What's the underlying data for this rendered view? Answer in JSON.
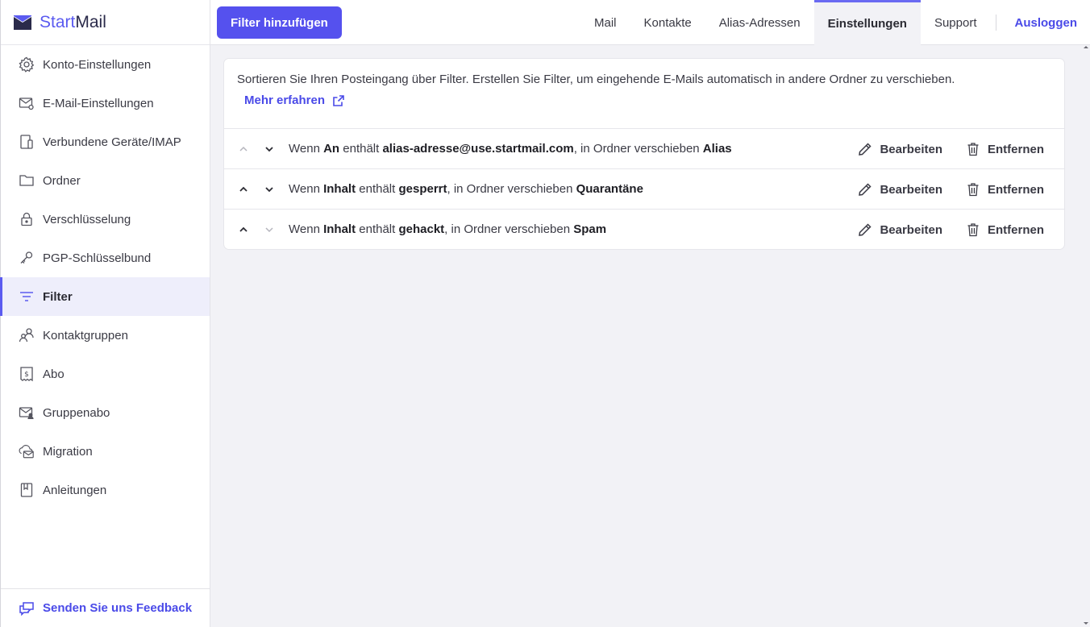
{
  "logo": {
    "part1": "Start",
    "part2": "Mail"
  },
  "sidebar": {
    "items": [
      {
        "label": "Konto-Einstellungen",
        "icon": "gear-icon"
      },
      {
        "label": "E-Mail-Einstellungen",
        "icon": "mail-settings-icon"
      },
      {
        "label": "Verbundene Geräte/IMAP",
        "icon": "devices-icon"
      },
      {
        "label": "Ordner",
        "icon": "folder-icon"
      },
      {
        "label": "Verschlüsselung",
        "icon": "lock-icon"
      },
      {
        "label": "PGP-Schlüsselbund",
        "icon": "key-icon"
      },
      {
        "label": "Filter",
        "icon": "filter-icon",
        "active": true
      },
      {
        "label": "Kontaktgruppen",
        "icon": "contact-group-icon"
      },
      {
        "label": "Abo",
        "icon": "subscription-icon"
      },
      {
        "label": "Gruppenabo",
        "icon": "group-mail-icon"
      },
      {
        "label": "Migration",
        "icon": "cloud-mail-icon"
      },
      {
        "label": "Anleitungen",
        "icon": "book-icon"
      }
    ],
    "feedback": "Senden Sie uns Feedback"
  },
  "toolbar": {
    "add_filter": "Filter hinzufügen"
  },
  "tabs": {
    "mail": "Mail",
    "contacts": "Kontakte",
    "alias": "Alias-Adressen",
    "settings": "Einstellungen",
    "support": "Support",
    "logout": "Ausloggen"
  },
  "main": {
    "description": "Sortieren Sie Ihren Posteingang über Filter. Erstellen Sie Filter, um eingehende E-Mails automatisch in andere Ordner zu verschieben.",
    "learn_more": "Mehr erfahren",
    "filters": [
      {
        "w1": "Wenn ",
        "field": "An",
        "w2": " enthält ",
        "value": "alias-adresse@use.startmail.com",
        "w3": ", in Ordner verschieben ",
        "folder": "Alias",
        "up_enabled": false,
        "down_enabled": true
      },
      {
        "w1": "Wenn ",
        "field": "Inhalt",
        "w2": " enthält ",
        "value": "gesperrt",
        "w3": ", in Ordner verschieben ",
        "folder": "Quarantäne",
        "up_enabled": true,
        "down_enabled": true
      },
      {
        "w1": "Wenn ",
        "field": "Inhalt",
        "w2": " enthält ",
        "value": "gehackt",
        "w3": ", in Ordner verschieben ",
        "folder": "Spam",
        "up_enabled": true,
        "down_enabled": false
      }
    ],
    "edit_label": "Bearbeiten",
    "remove_label": "Entfernen"
  },
  "colors": {
    "accent": "#5551ee",
    "link": "#4a4ae8",
    "background": "#f2f2f6"
  }
}
